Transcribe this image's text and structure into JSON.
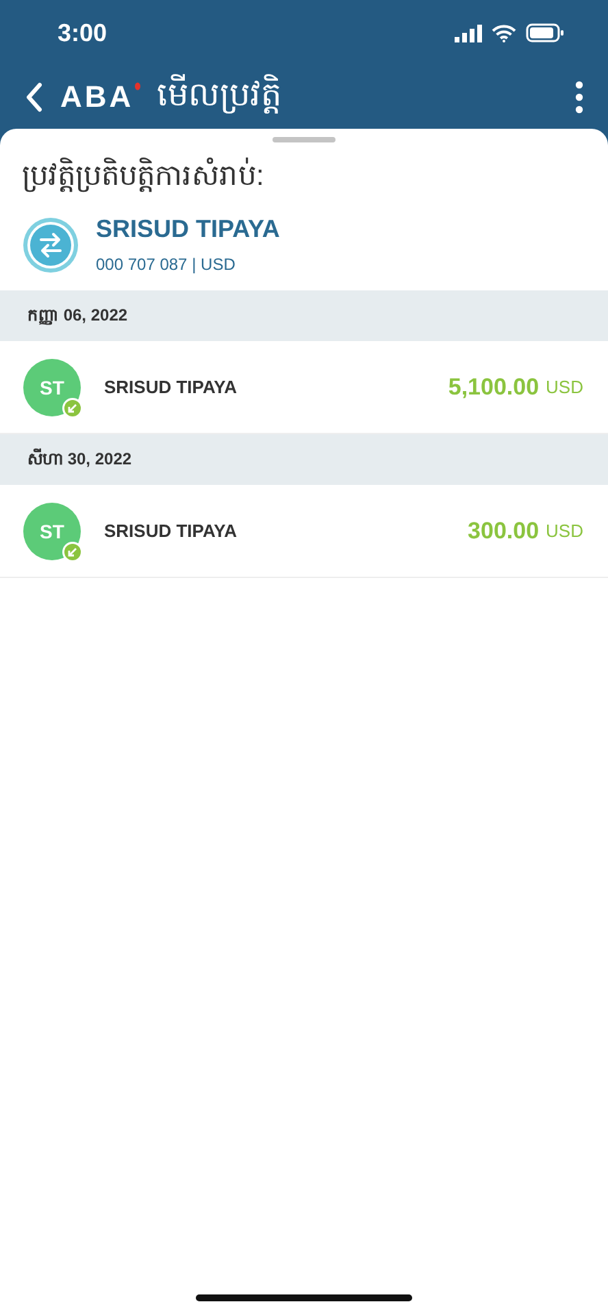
{
  "status_bar": {
    "time": "3:00"
  },
  "header": {
    "logo": "ABA",
    "title": "មើលប្រវត្តិ"
  },
  "account": {
    "heading": "ប្រវត្តិប្រតិបត្តិការសំរាប់:",
    "name": "SRISUD TIPAYA",
    "number": "000 707 087",
    "separator": "|",
    "currency": "USD"
  },
  "groups": [
    {
      "date": "កញ្ញា 06, 2022",
      "transactions": [
        {
          "initials": "ST",
          "name": "SRISUD TIPAYA",
          "amount": "5,100.00",
          "currency": "USD"
        }
      ]
    },
    {
      "date": "សីហា 30, 2022",
      "transactions": [
        {
          "initials": "ST",
          "name": "SRISUD TIPAYA",
          "amount": "300.00",
          "currency": "USD"
        }
      ]
    }
  ]
}
